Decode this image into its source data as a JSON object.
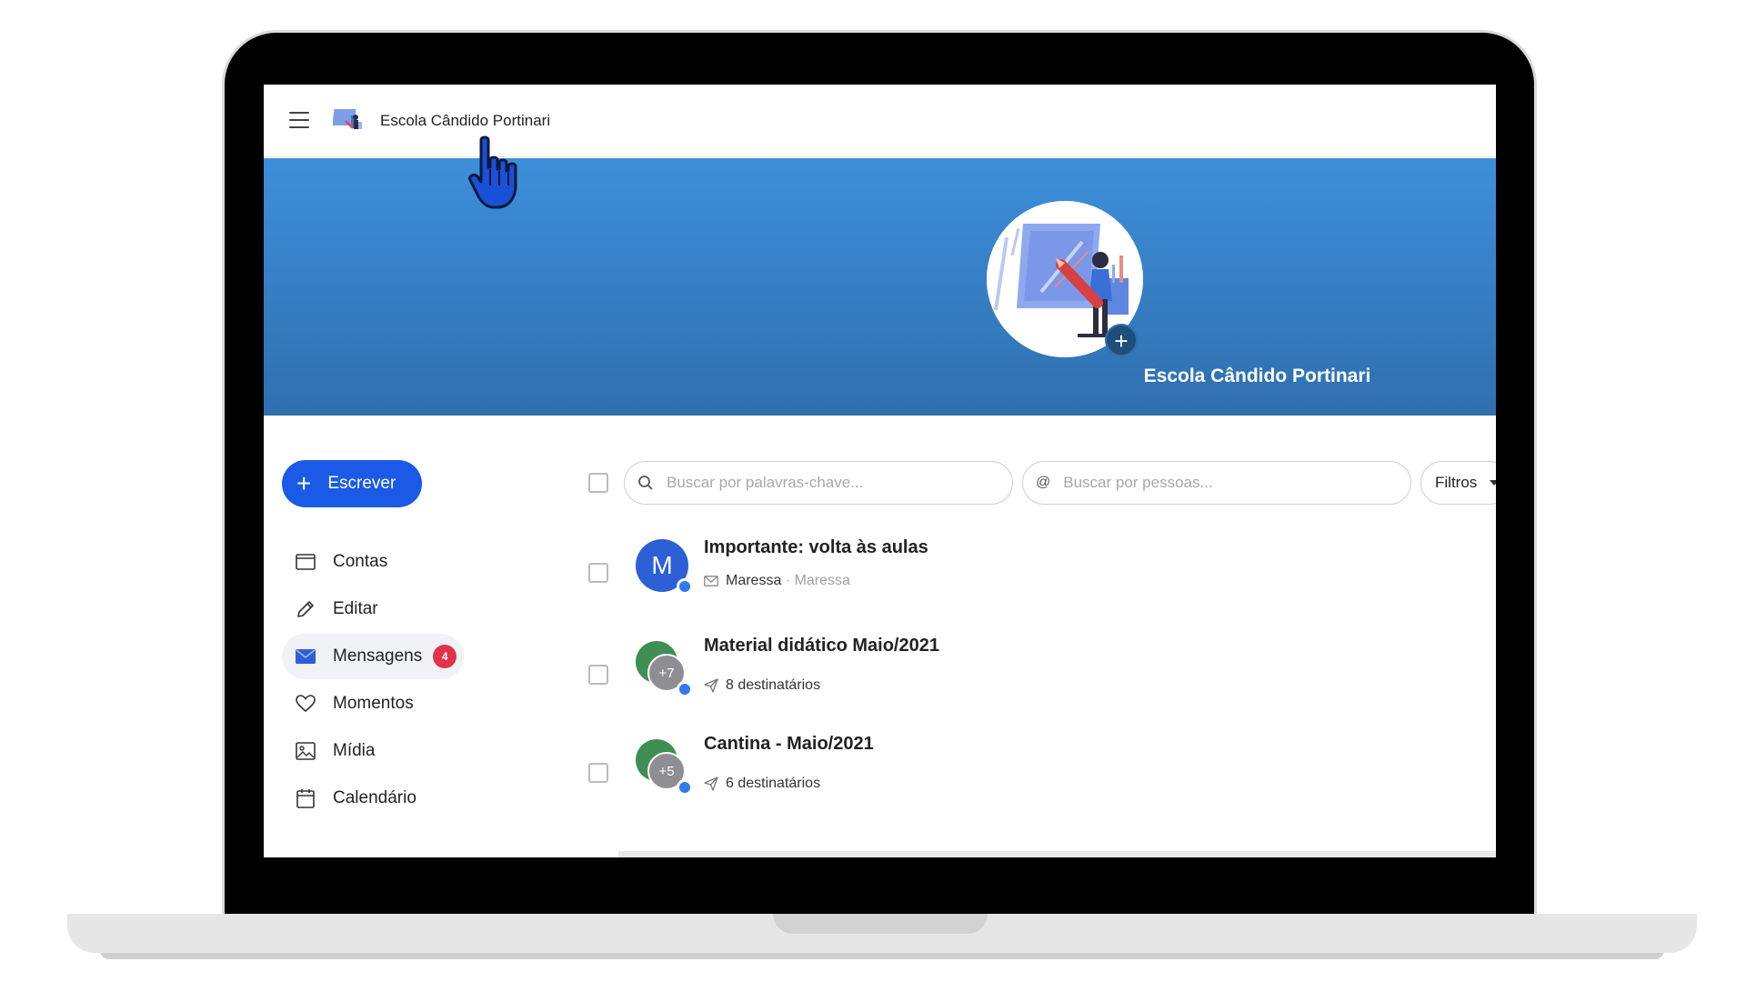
{
  "app": {
    "school_name": "Escola Cândido Portinari"
  },
  "banner": {
    "title": "Escola Cândido Portinari"
  },
  "toolbar": {
    "compose_label": "Escrever",
    "keyword_search_placeholder": "Buscar por palavras-chave...",
    "people_search_placeholder": "Buscar por pessoas...",
    "filters_label": "Filtros"
  },
  "sidebar": {
    "items": [
      {
        "label": "Contas",
        "icon": "calendar-card-icon"
      },
      {
        "label": "Editar",
        "icon": "pencil-icon"
      },
      {
        "label": "Mensagens",
        "icon": "envelope-icon",
        "badge": "4",
        "active": true
      },
      {
        "label": "Momentos",
        "icon": "heart-icon"
      },
      {
        "label": "Mídia",
        "icon": "image-icon"
      },
      {
        "label": "Calendário",
        "icon": "calendar-icon"
      }
    ]
  },
  "messages": [
    {
      "subject": "Importante: volta às aulas",
      "avatar": "M",
      "sender": "Maressa",
      "sender_secondary": "Maressa",
      "sep": " · "
    },
    {
      "subject": "Material didático Maio/2021",
      "avatar_count": "+7",
      "recipients": "8 destinatários"
    },
    {
      "subject": "Cantina - Maio/2021",
      "avatar_count": "+5",
      "recipients": "6 destinatários"
    }
  ],
  "colors": {
    "primary": "#1a5ae6",
    "banner_top": "#3d8fdb",
    "banner_bottom": "#2f6fae",
    "badge": "#e0334a",
    "avatar_blue": "#2d5fd6",
    "avatar_green": "#3f8e52"
  }
}
